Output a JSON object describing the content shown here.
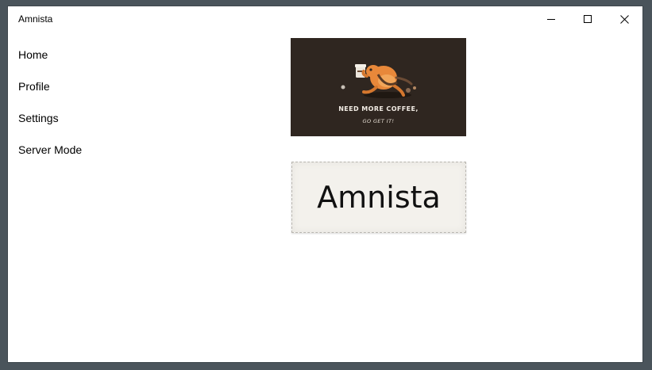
{
  "window": {
    "title": "Amnista"
  },
  "caption_buttons": {
    "minimize_icon": "minimize-icon",
    "maximize_icon": "maximize-icon",
    "close_icon": "close-icon"
  },
  "nav": {
    "items": [
      {
        "label": "Home"
      },
      {
        "label": "Profile"
      },
      {
        "label": "Settings"
      },
      {
        "label": "Server Mode"
      }
    ]
  },
  "main": {
    "banner": {
      "line1": "NEED MORE COFFEE,",
      "line2": "GO GET IT!",
      "background": "#2f2620"
    },
    "logo": {
      "text": "Amnista"
    }
  }
}
